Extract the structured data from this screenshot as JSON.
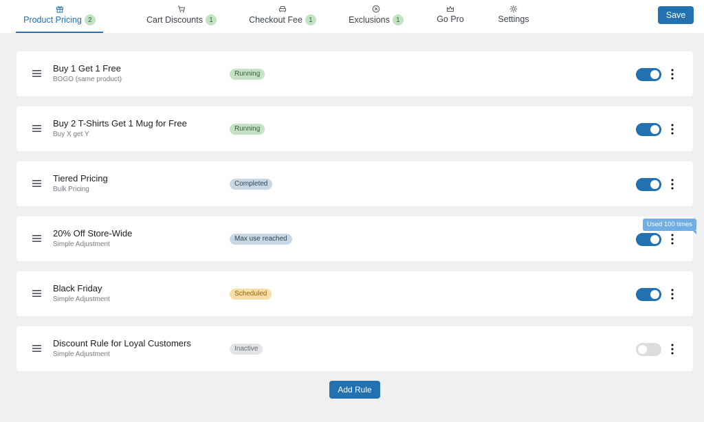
{
  "tabs": [
    {
      "label": "Product Pricing",
      "badge": "2",
      "icon": "gift-icon",
      "active": true
    },
    {
      "label": "Cart Discounts",
      "badge": "1",
      "icon": "cart-icon"
    },
    {
      "label": "Checkout Fee",
      "badge": "1",
      "icon": "car-icon"
    },
    {
      "label": "Exclusions",
      "badge": "1",
      "icon": "circle-x-icon"
    },
    {
      "label": "Go Pro",
      "badge": "",
      "icon": "crown-icon"
    },
    {
      "label": "Settings",
      "badge": "",
      "icon": "gear-icon"
    }
  ],
  "toolbar": {
    "save_label": "Save"
  },
  "rules": [
    {
      "title": "Buy 1 Get 1 Free",
      "subtitle": "BOGO (same product)",
      "status": "Running",
      "enabled": true
    },
    {
      "title": "Buy 2 T-Shirts Get 1 Mug for Free",
      "subtitle": "Buy X get Y",
      "status": "Running",
      "enabled": true
    },
    {
      "title": "Tiered Pricing",
      "subtitle": "Bulk Pricing",
      "status": "Completed",
      "enabled": true
    },
    {
      "title": "20% Off Store-Wide",
      "subtitle": "Simple Adjustment",
      "status": "Max use reached",
      "enabled": true
    },
    {
      "title": "Black Friday",
      "subtitle": "Simple Adjustment",
      "status": "Scheduled",
      "enabled": true
    },
    {
      "title": "Discount Rule for Loyal Customers",
      "subtitle": "Simple Adjustment",
      "status": "Inactive",
      "enabled": false
    }
  ],
  "tooltip": {
    "text": "Used 100 times"
  },
  "footer": {
    "add_rule_label": "Add Rule"
  },
  "colors": {
    "accent": "#2271b1",
    "running": "#c6e1c6",
    "completed": "#c8d7e1",
    "scheduled": "#f8dda7",
    "inactive": "#e2e4e7"
  }
}
